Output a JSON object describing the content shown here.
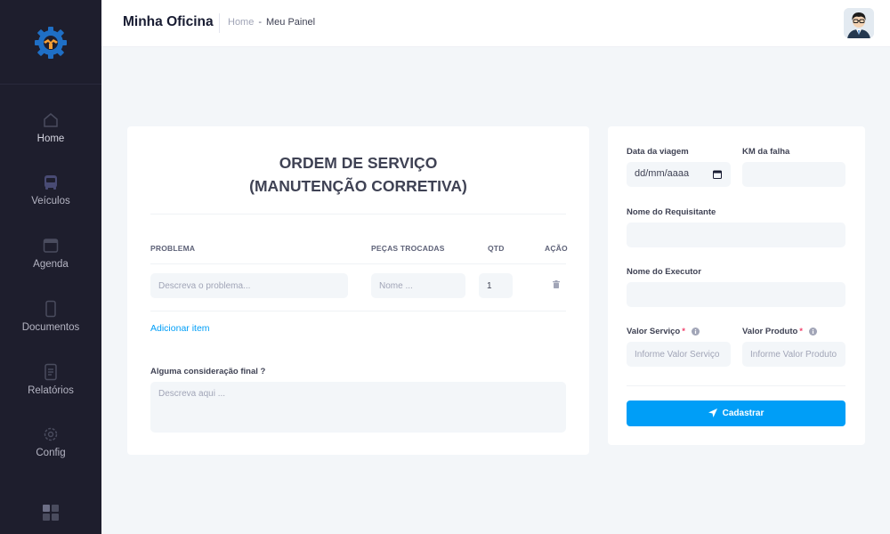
{
  "header": {
    "app_title": "Minha Oficina",
    "breadcrumb_home": "Home",
    "breadcrumb_separator": "-",
    "breadcrumb_current": "Meu Painel"
  },
  "sidebar": {
    "items": [
      {
        "label": "Home",
        "icon": "home-icon"
      },
      {
        "label": "Veículos",
        "icon": "bus-icon"
      },
      {
        "label": "Agenda",
        "icon": "calendar-icon"
      },
      {
        "label": "Documentos",
        "icon": "mobile-icon"
      },
      {
        "label": "Relatórios",
        "icon": "file-icon"
      },
      {
        "label": "Config",
        "icon": "gear-icon"
      }
    ]
  },
  "order": {
    "title_line1": "ORDEM DE SERVIÇO",
    "title_line2": "(MANUTENÇÃO CORRETIVA)",
    "columns": [
      "PROBLEMA",
      "PEÇAS TROCADAS",
      "QTD",
      "AÇÃO"
    ],
    "row": {
      "problem_placeholder": "Descreva o problema...",
      "parts_placeholder": "Nome ...",
      "qty_value": "1"
    },
    "add_item": "Adicionar item",
    "final_label": "Alguma consideração final ?",
    "final_placeholder": "Descreva aqui ..."
  },
  "form": {
    "date_label": "Data da viagem",
    "date_value": "dd/mm/aaaa",
    "km_label": "KM da falha",
    "requester_label": "Nome do Requisitante",
    "executor_label": "Nome do Executor",
    "service_value_label": "Valor Serviço",
    "service_value_placeholder": "Informe Valor Serviço",
    "product_value_label": "Valor Produto",
    "product_value_placeholder": "Informe Valor Produto",
    "required_mark": "*",
    "submit_label": "Cadastrar"
  },
  "colors": {
    "sidebar_bg": "#1e1e2d",
    "primary": "#009ef7",
    "required": "#f1416c"
  }
}
